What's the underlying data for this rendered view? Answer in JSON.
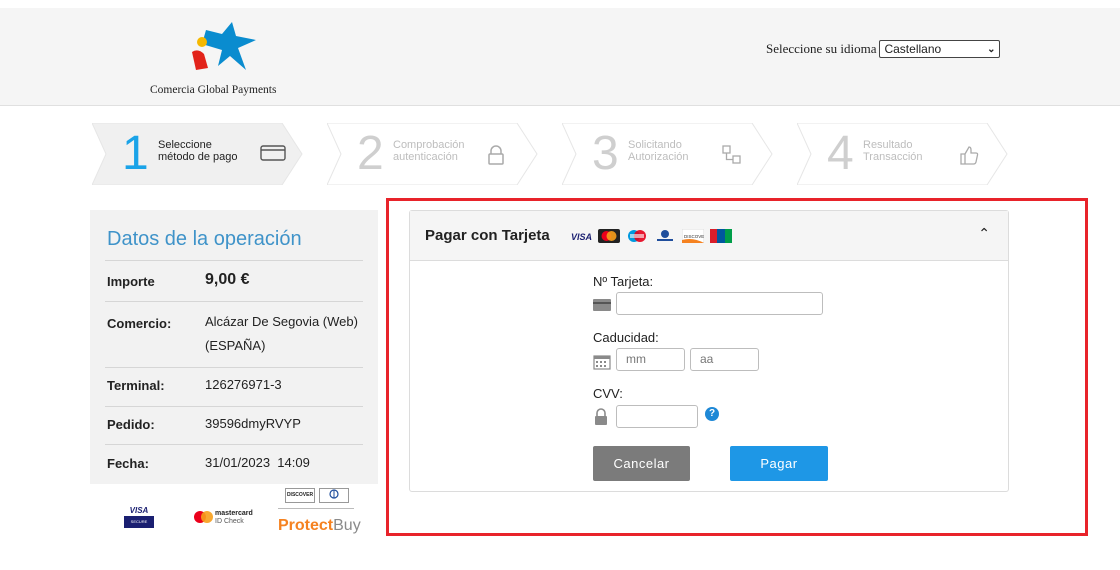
{
  "header": {
    "logo_text": "Comercia Global Payments",
    "language_label": "Seleccione su idioma",
    "language_selected": "Castellano"
  },
  "steps": [
    {
      "number": "1",
      "label": "Seleccione\nmétodo de pago",
      "icon": "credit-card-icon",
      "active": true
    },
    {
      "number": "2",
      "label": "Comprobación\nautenticación",
      "icon": "lock-icon",
      "active": false
    },
    {
      "number": "3",
      "label": "Solicitando\nAutorización",
      "icon": "network-icon",
      "active": false
    },
    {
      "number": "4",
      "label": "Resultado\nTransacción",
      "icon": "thumbs-up-icon",
      "active": false
    }
  ],
  "operation": {
    "title": "Datos de la operación",
    "rows": [
      {
        "label": "Importe",
        "value": "9,00 €"
      },
      {
        "label": "Comercio:",
        "value": "Alcázar De Segovia (Web)\n(ESPAÑA)"
      },
      {
        "label": "Terminal:",
        "value": "126276971-3"
      },
      {
        "label": "Pedido:",
        "value": "39596dmyRVYP"
      },
      {
        "label": "Fecha:",
        "value": "31/01/2023  14:09"
      }
    ]
  },
  "security_logos": {
    "visa_top": "VISA",
    "visa_bottom": "SECURE",
    "mastercard_line1": "mastercard",
    "mastercard_line2": "ID Check",
    "discover": "DISCOVER",
    "protectbuy": "Protect",
    "protectbuy_suffix": "Buy"
  },
  "card_form": {
    "title": "Pagar con Tarjeta",
    "card_number_label": "Nº Tarjeta:",
    "card_number_value": "",
    "expiry_label": "Caducidad:",
    "month_placeholder": "mm",
    "year_placeholder": "aa",
    "cvv_label": "CVV:",
    "cvv_value": "",
    "help_symbol": "?",
    "cancel_label": "Cancelar",
    "pay_label": "Pagar",
    "collapse_symbol": "⌃",
    "brand_icons": [
      "visa-icon",
      "mastercard-icon",
      "maestro-icon",
      "diners-icon",
      "discover-icon",
      "jcb-icon"
    ]
  },
  "colors": {
    "accent_blue": "#1aa3e8",
    "title_blue": "#3f93c9",
    "pay_button": "#1e97e6",
    "cancel_button": "#7b7b7b",
    "highlight_red": "#e8232a"
  }
}
